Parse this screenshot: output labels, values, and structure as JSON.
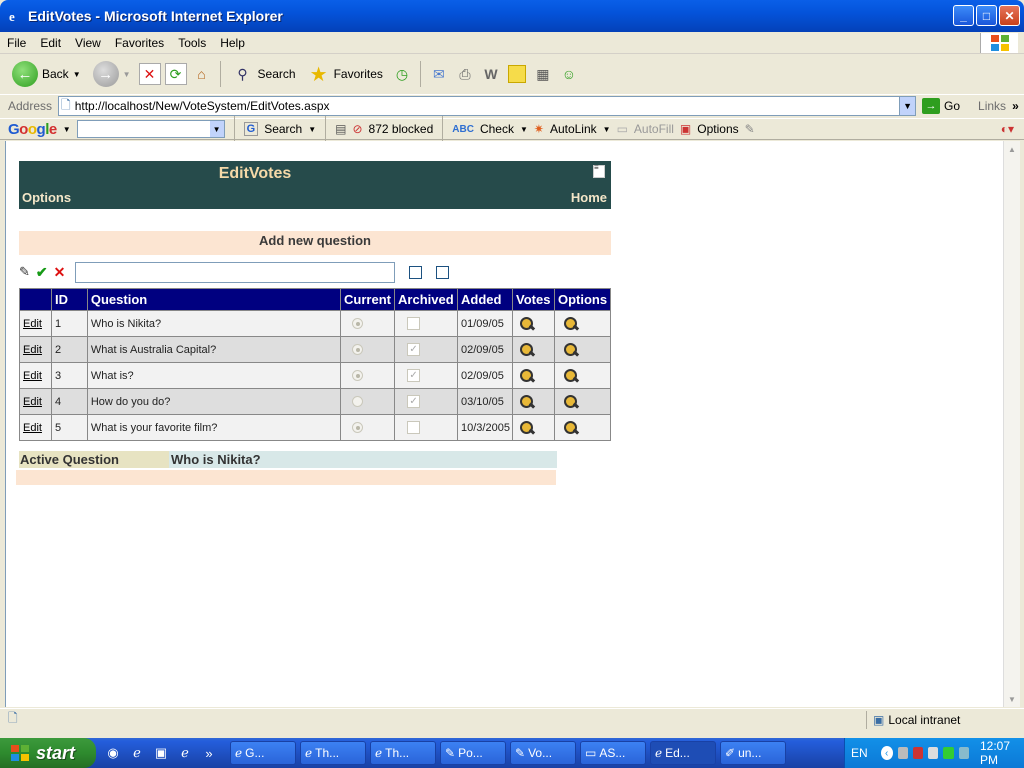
{
  "window": {
    "title": "EditVotes - Microsoft Internet Explorer"
  },
  "menu": [
    "File",
    "Edit",
    "View",
    "Favorites",
    "Tools",
    "Help"
  ],
  "toolbar": {
    "back": "Back",
    "search": "Search",
    "favorites": "Favorites"
  },
  "address": {
    "label": "Address",
    "url": "http://localhost/New/VoteSystem/EditVotes.aspx",
    "go": "Go",
    "links": "Links"
  },
  "googlebar": {
    "logo": "Google",
    "search": "Search",
    "blocked": "872 blocked",
    "check": "Check",
    "autolink": "AutoLink",
    "autofill": "AutoFill",
    "options": "Options"
  },
  "page": {
    "title": "EditVotes",
    "options_link": "Options",
    "home_link": "Home",
    "add_new": "Add new question",
    "table": {
      "headers": [
        "",
        "ID",
        "Question",
        "Current",
        "Archived",
        "Added",
        "Votes",
        "Options"
      ],
      "rows": [
        {
          "edit": "Edit",
          "id": "1",
          "question": "Who is Nikita?",
          "current": true,
          "archived": false,
          "added": "01/09/05"
        },
        {
          "edit": "Edit",
          "id": "2",
          "question": "What is Australia Capital?",
          "current": true,
          "archived": true,
          "added": "02/09/05"
        },
        {
          "edit": "Edit",
          "id": "3",
          "question": "What is?",
          "current": true,
          "archived": true,
          "added": "02/09/05"
        },
        {
          "edit": "Edit",
          "id": "4",
          "question": "How do you do?",
          "current": false,
          "archived": true,
          "added": "03/10/05"
        },
        {
          "edit": "Edit",
          "id": "5",
          "question": "What is your favorite film?",
          "current": true,
          "archived": false,
          "added": "10/3/2005"
        }
      ]
    },
    "active_label": "Active Question",
    "active_value": "Who is Nikita?"
  },
  "status": {
    "zone": "Local intranet"
  },
  "taskbar": {
    "start": "start",
    "tasks": [
      "G...",
      "Th...",
      "Th...",
      "Po...",
      "Vo...",
      "AS...",
      "Ed...",
      "un..."
    ],
    "lang": "EN",
    "clock": "12:07 PM"
  }
}
